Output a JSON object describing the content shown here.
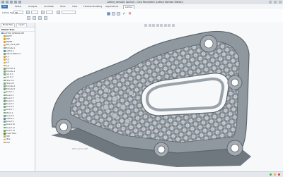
{
  "window": {
    "title": "Lattice_demo01 (Active) - Creo Parametric (Lattice Domain Edition)"
  },
  "ribbon": {
    "tabs": [
      "File",
      "Model",
      "Analysis",
      "Annotate",
      "Tools",
      "View",
      "Flexible Modeling",
      "Applications",
      "Lattice"
    ],
    "active_tab": "Lattice"
  },
  "toolbar": {
    "lattice_type_label": "Lattice Type",
    "lattice_type_value": "3D",
    "ok_glyph": "✓",
    "cancel_glyph": "✕"
  },
  "sidebar": {
    "tabs": [
      "Model Tree",
      "Layers"
    ],
    "header": "Model Tree",
    "root": "LATTICE_DEMO01.PRT",
    "items": [
      {
        "label": "RIGHT",
        "color": "#e0a23a"
      },
      {
        "label": "TOP",
        "color": "#e0a23a"
      },
      {
        "label": "FRONT",
        "color": "#e0a23a"
      },
      {
        "label": "PRT_CSYS_DEF",
        "color": "#e0a23a"
      },
      {
        "label": "Extrude 1",
        "color": "#7aa37a"
      },
      {
        "label": "Lattice 1",
        "color": "#5a86c4"
      },
      {
        "label": "Datum Pattern 1",
        "color": "#7aa37a"
      },
      {
        "label": "A_1",
        "color": "#e0a23a"
      },
      {
        "label": "A_2",
        "color": "#e0a23a"
      },
      {
        "label": "A_3",
        "color": "#e0a23a"
      },
      {
        "label": "A_4",
        "color": "#e0a23a"
      },
      {
        "label": "Extrude 2",
        "color": "#7aa37a"
      },
      {
        "label": "Extrude 3",
        "color": "#7aa37a"
      },
      {
        "label": "Cut id 1",
        "color": "#7aa37a"
      },
      {
        "label": "Cut id 2",
        "color": "#7aa37a"
      },
      {
        "label": "Hole id 1",
        "color": "#7aa37a"
      },
      {
        "label": "Hole id 2",
        "color": "#7aa37a"
      },
      {
        "label": "Extrude 4",
        "color": "#7aa37a"
      },
      {
        "label": "Extrude 5",
        "color": "#7aa37a"
      },
      {
        "label": "Round 1",
        "color": "#7aa37a"
      },
      {
        "label": "Round 2",
        "color": "#7aa37a"
      },
      {
        "label": "Round 3",
        "color": "#7aa37a"
      },
      {
        "label": "Round 4",
        "color": "#7aa37a"
      },
      {
        "label": "Round 5",
        "color": "#7aa37a"
      },
      {
        "label": "Round 6",
        "color": "#7aa37a"
      },
      {
        "label": "Round 7",
        "color": "#7aa37a"
      },
      {
        "label": "Mirror 1",
        "color": "#7aa37a"
      },
      {
        "label": "Round 8",
        "color": "#7aa37a"
      },
      {
        "label": "Lattice 2",
        "color": "#5a86c4"
      },
      {
        "label": "Round 9",
        "color": "#7aa37a"
      },
      {
        "label": "Round 10",
        "color": "#7aa37a"
      },
      {
        "label": "Round 11",
        "color": "#7aa37a"
      },
      {
        "label": "Round 12",
        "color": "#7aa37a"
      },
      {
        "label": "Insert Here",
        "color": "#2f8f2f"
      },
      {
        "label": "TOP",
        "color": "#e0a23a"
      },
      {
        "label": "Hide",
        "color": "#b0b7bf"
      },
      {
        "label": "AQ2",
        "color": "#e0a23a"
      }
    ]
  },
  "canvas": {
    "csys_label": "PRT_CSYS_DEF",
    "part_color": "#8f979f",
    "lattice_color": "#c9ced3"
  },
  "status_colors": [
    "#3fb34f",
    "#f0b429",
    "#d64545"
  ]
}
